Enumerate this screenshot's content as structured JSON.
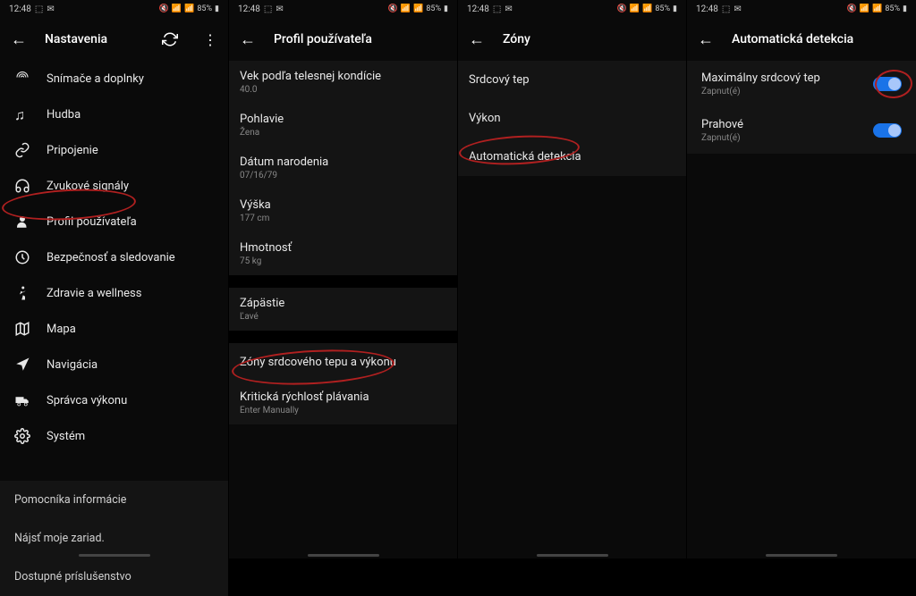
{
  "status": {
    "time": "12:48",
    "battery": "85%"
  },
  "panel1": {
    "title": "Nastavenia",
    "items": [
      {
        "label": "Snímače a doplnky"
      },
      {
        "label": "Hudba"
      },
      {
        "label": "Pripojenie"
      },
      {
        "label": "Zvukové signály"
      },
      {
        "label": "Profil používateľa"
      },
      {
        "label": "Bezpečnosť a sledovanie"
      },
      {
        "label": "Zdravie a wellness"
      },
      {
        "label": "Mapa"
      },
      {
        "label": "Navigácia"
      },
      {
        "label": "Správca výkonu"
      },
      {
        "label": "Systém"
      }
    ],
    "footer": [
      {
        "label": "Pomocníka informácie"
      },
      {
        "label": "Nájsť moje zariad."
      },
      {
        "label": "Dostupné príslušenstvo"
      }
    ]
  },
  "panel2": {
    "title": "Profil používateľa",
    "sec1": [
      {
        "t": "Vek podľa telesnej kondície",
        "s": "40.0"
      },
      {
        "t": "Pohlavie",
        "s": "Žena"
      },
      {
        "t": "Dátum narodenia",
        "s": "07/16/79"
      },
      {
        "t": "Výška",
        "s": "177 cm"
      },
      {
        "t": "Hmotnosť",
        "s": "75 kg"
      }
    ],
    "sec2": [
      {
        "t": "Zápästie",
        "s": "Ľavé"
      }
    ],
    "sec3": [
      {
        "t": "Zóny srdcového tepu a výkonu",
        "s": ""
      },
      {
        "t": "Kritická rýchlosť plávania",
        "s": "Enter Manually"
      }
    ]
  },
  "panel3": {
    "title": "Zóny",
    "items": [
      {
        "t": "Srdcový tep"
      },
      {
        "t": "Výkon"
      },
      {
        "t": "Automatická detekcia"
      }
    ]
  },
  "panel4": {
    "title": "Automatická detekcia",
    "items": [
      {
        "t": "Maximálny srdcový tep",
        "s": "Zapnut(é)"
      },
      {
        "t": "Prahové",
        "s": "Zapnut(é)"
      }
    ]
  }
}
